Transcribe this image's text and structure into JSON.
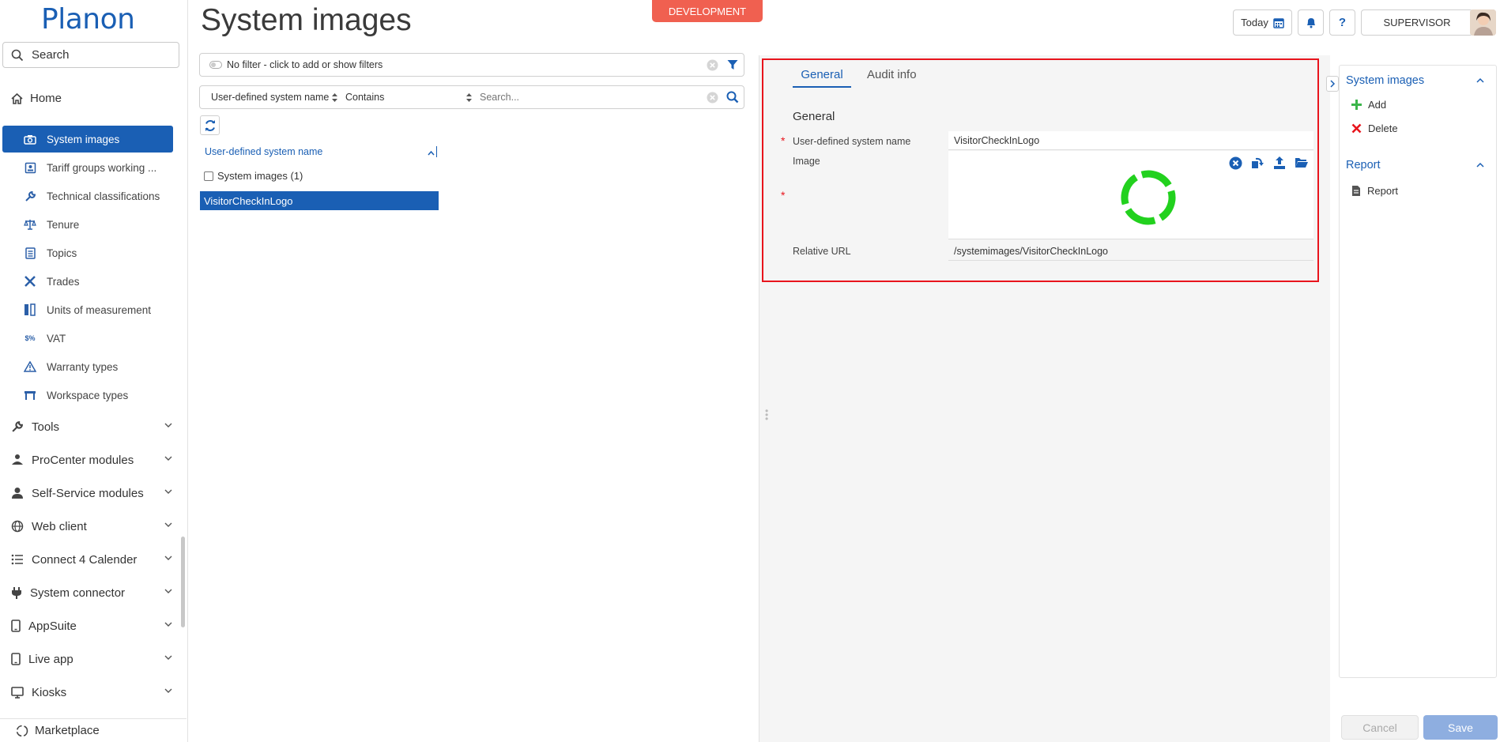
{
  "app": {
    "logo": "Planon",
    "page_title": "System images",
    "environment_badge": "DEVELOPMENT"
  },
  "header": {
    "today_label": "Today",
    "help_label": "?",
    "user_label": "SUPERVISOR"
  },
  "sidebar": {
    "search_label": "Search",
    "home_label": "Home",
    "items": [
      {
        "label": "System images",
        "icon": "camera-icon",
        "active": true
      },
      {
        "label": "Tariff groups working ...",
        "icon": "badge-icon"
      },
      {
        "label": "Technical classifications",
        "icon": "wrench-icon"
      },
      {
        "label": "Tenure",
        "icon": "scale-icon"
      },
      {
        "label": "Topics",
        "icon": "list-icon"
      },
      {
        "label": "Trades",
        "icon": "tools-icon"
      },
      {
        "label": "Units of measurement",
        "icon": "ruler-icon"
      },
      {
        "label": "VAT",
        "icon": "vat-icon"
      },
      {
        "label": "Warranty types",
        "icon": "warning-icon"
      },
      {
        "label": "Workspace types",
        "icon": "desk-icon"
      }
    ],
    "groups": [
      {
        "label": "Tools",
        "icon": "wrench-icon"
      },
      {
        "label": "ProCenter modules",
        "icon": "procenter-icon"
      },
      {
        "label": "Self-Service modules",
        "icon": "person-icon"
      },
      {
        "label": "Web client",
        "icon": "globe-icon"
      },
      {
        "label": "Connect 4 Calender",
        "icon": "list-icon"
      },
      {
        "label": "System connector",
        "icon": "plug-icon"
      },
      {
        "label": "AppSuite",
        "icon": "mobile-icon"
      },
      {
        "label": "Live app",
        "icon": "mobile-icon"
      },
      {
        "label": "Kiosks",
        "icon": "monitor-icon"
      }
    ],
    "marketplace_label": "Marketplace"
  },
  "list": {
    "filter_text": "No filter - click to add or show filters",
    "search_field": "User-defined system name",
    "search_operator": "Contains",
    "search_placeholder": "Search...",
    "column_header": "User-defined system name",
    "group_label": "System images (1)",
    "rows": [
      "VisitorCheckInLogo"
    ]
  },
  "detail": {
    "tabs": [
      "General",
      "Audit info"
    ],
    "section_title": "General",
    "fields": {
      "name_label": "User-defined system name",
      "name_value": "VisitorCheckInLogo",
      "image_label": "Image",
      "url_label": "Relative URL",
      "url_value": "/systemimages/VisitorCheckInLogo"
    }
  },
  "actions": {
    "section1_title": "System images",
    "add_label": "Add",
    "delete_label": "Delete",
    "section2_title": "Report",
    "report_label": "Report"
  },
  "footer": {
    "cancel_label": "Cancel",
    "save_label": "Save"
  },
  "colors": {
    "accent": "#1a5fb4",
    "badge": "#f06050",
    "highlight_border": "#e8141c",
    "add": "#3bb54a",
    "delete": "#e8141c",
    "image_ring": "#22d11e"
  }
}
